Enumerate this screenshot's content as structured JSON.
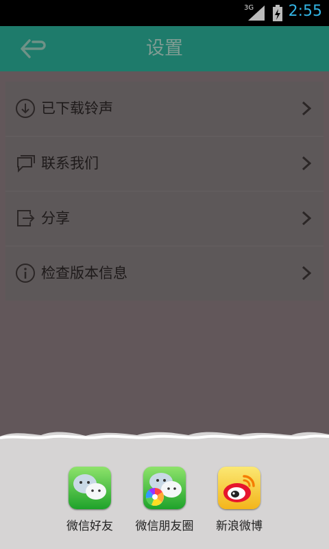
{
  "status_bar": {
    "network": "3G",
    "time": "2:55"
  },
  "header": {
    "title": "设置"
  },
  "menu": {
    "items": [
      {
        "label": "已下载铃声",
        "icon": "download-icon"
      },
      {
        "label": "联系我们",
        "icon": "chat-bubble-icon"
      },
      {
        "label": "分享",
        "icon": "share-icon"
      },
      {
        "label": "检查版本信息",
        "icon": "info-icon"
      }
    ]
  },
  "share": {
    "items": [
      {
        "label": "微信好友",
        "icon": "wechat-icon"
      },
      {
        "label": "微信朋友圈",
        "icon": "wechat-moments-icon"
      },
      {
        "label": "新浪微博",
        "icon": "weibo-icon"
      }
    ]
  },
  "colors": {
    "title_bar": "#1e7b6b",
    "overlay_background": "#62575a",
    "status_clock": "#33b5e5",
    "share_panel": "#d6d4d4"
  }
}
